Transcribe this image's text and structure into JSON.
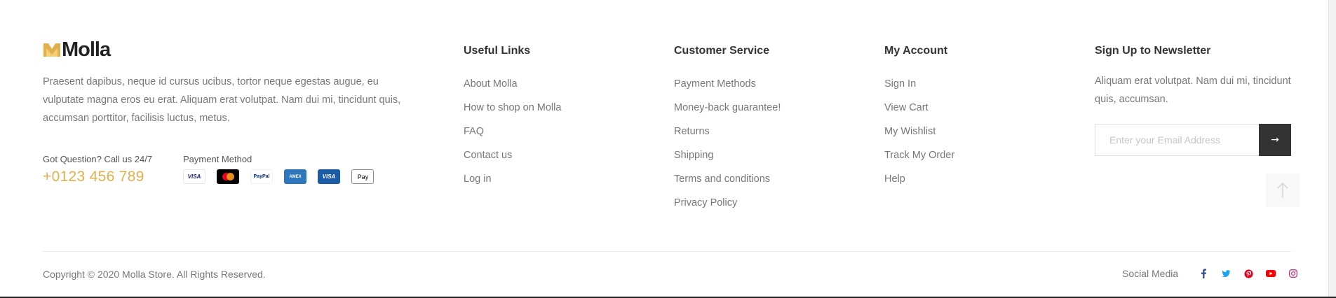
{
  "brand": {
    "name": "Molla",
    "accent_color": "#e2b04a",
    "description": "Praesent dapibus, neque id cursus ucibus, tortor neque egestas augue, eu vulputate magna eros eu erat. Aliquam erat volutpat. Nam dui mi, tincidunt quis, accumsan porttitor, facilisis luctus, metus."
  },
  "contact": {
    "label": "Got Question? Call us 24/7",
    "phone": "+0123 456 789"
  },
  "payment": {
    "label": "Payment Method",
    "cards": [
      {
        "name": "visa",
        "text": "VISA"
      },
      {
        "name": "mastercard",
        "text": ""
      },
      {
        "name": "paypal",
        "text": "PayPal"
      },
      {
        "name": "american-express",
        "text": "AMEX"
      },
      {
        "name": "visa-electron",
        "text": "VISA"
      },
      {
        "name": "apple-pay",
        "text": "Pay"
      }
    ]
  },
  "columns": {
    "useful": {
      "title": "Useful Links",
      "items": [
        "About Molla",
        "How to shop on Molla",
        "FAQ",
        "Contact us",
        "Log in"
      ]
    },
    "service": {
      "title": "Customer Service",
      "items": [
        "Payment Methods",
        "Money-back guarantee!",
        "Returns",
        "Shipping",
        "Terms and conditions",
        "Privacy Policy"
      ]
    },
    "account": {
      "title": "My Account",
      "items": [
        "Sign In",
        "View Cart",
        "My Wishlist",
        "Track My Order",
        "Help"
      ]
    }
  },
  "newsletter": {
    "title": "Sign Up to Newsletter",
    "text": "Aliquam erat volutpat. Nam dui mi, tincidunt quis, accumsan.",
    "placeholder": "Enter your Email Address",
    "button_icon": "arrow-right-icon",
    "button_symbol": "→"
  },
  "scroll_top": {
    "icon": "arrow-up-icon"
  },
  "bottom": {
    "copyright": "Copyright © 2020 Molla Store. All Rights Reserved.",
    "social_label": "Social Media",
    "social": [
      {
        "name": "facebook-icon",
        "color": "#3b5998"
      },
      {
        "name": "twitter-icon",
        "color": "#1da1f2"
      },
      {
        "name": "pinterest-icon",
        "color": "#e60023"
      },
      {
        "name": "youtube-icon",
        "color": "#ff0000"
      },
      {
        "name": "instagram-icon",
        "color": "#c13584"
      }
    ]
  }
}
